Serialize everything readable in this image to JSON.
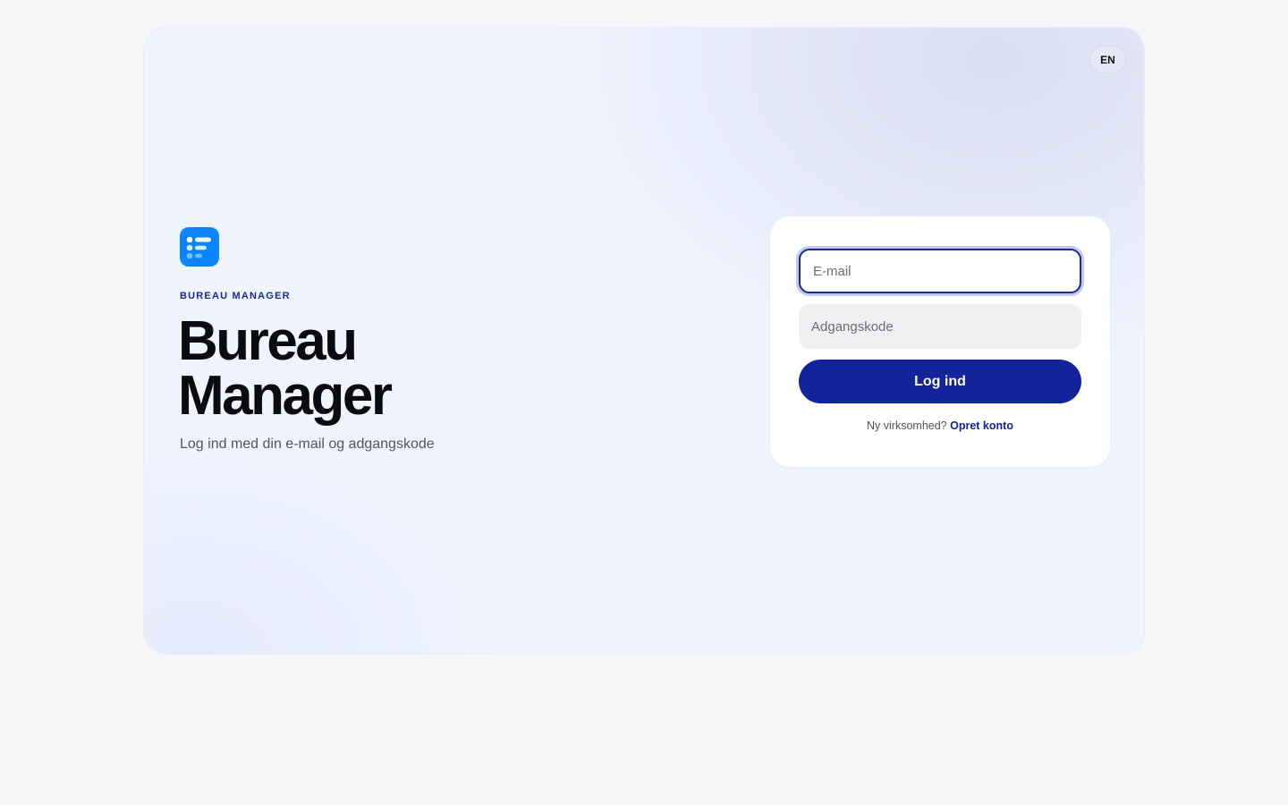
{
  "header": {
    "language_button": "EN"
  },
  "brand": {
    "eyebrow": "BUREAU MANAGER",
    "title_line1": "Bureau",
    "title_line2": "Manager",
    "subtitle": "Log ind med din e-mail og adgangskode",
    "logo_icon": "list-icon",
    "accent_color": "#0a84ff"
  },
  "login_form": {
    "email_placeholder": "E-mail",
    "email_value": "",
    "password_placeholder": "Adgangskode",
    "password_value": "",
    "submit_label": "Log ind",
    "signup_prompt": "Ny virksomhed?",
    "signup_link": "Opret konto",
    "primary_color": "#13239b"
  }
}
